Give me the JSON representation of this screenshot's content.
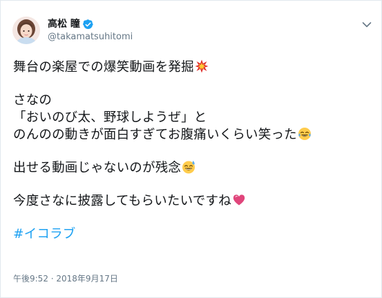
{
  "tweet": {
    "display_name": "高松 瞳",
    "handle": "@takamatsuhitomi",
    "lines": {
      "l1": "舞台の楽屋での爆笑動画を発掘",
      "l2": "さなの",
      "l3": "「おいのび太、野球しようぜ」と",
      "l4": "のんのの動きが面白すぎてお腹痛いくらい笑った",
      "l5": "出せる動画じゃないのが残念",
      "l6": "今度さなに披露してもらいたいですね"
    },
    "hashtag": "#イコラブ",
    "timestamp": "午後9:52 · 2018年9月17日"
  },
  "icons": {
    "verified": "verified-badge-icon",
    "caret": "chevron-down-icon",
    "emoji_1": "collision-emoji",
    "emoji_2": "tears-of-joy-emoji",
    "emoji_3": "grinning-sweat-emoji",
    "emoji_4": "sparkling-heart-emoji"
  },
  "colors": {
    "link": "#1da1f2",
    "text": "#14171a",
    "secondary": "#657786",
    "border": "#e1e8ed"
  }
}
